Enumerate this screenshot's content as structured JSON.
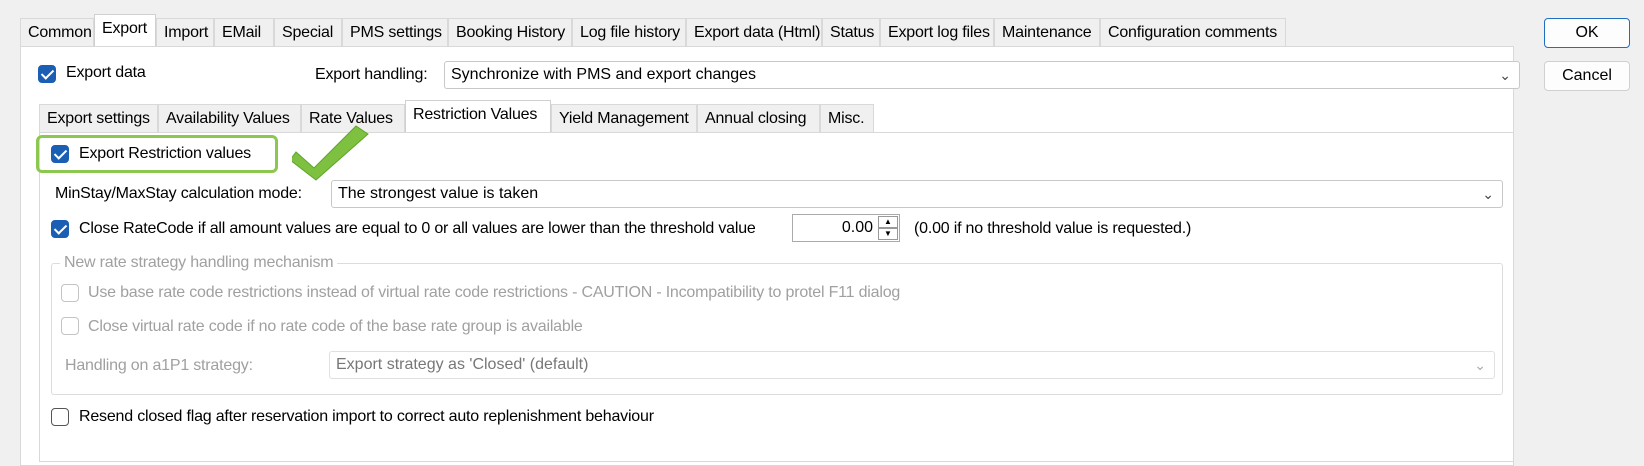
{
  "main_tabs": [
    "Common",
    "Export",
    "Import",
    "EMail",
    "Special",
    "PMS settings",
    "Booking History",
    "Log file history",
    "Export data (Html)",
    "Status",
    "Export log files",
    "Maintenance",
    "Configuration comments"
  ],
  "buttons": {
    "ok": "OK",
    "cancel": "Cancel"
  },
  "export_data": {
    "label": "Export data",
    "checked": true
  },
  "export_handling": {
    "label": "Export handling:",
    "value": "Synchronize with PMS and export changes"
  },
  "sub_tabs": [
    "Export settings",
    "Availability Values",
    "Rate Values",
    "Restriction Values",
    "Yield Management",
    "Annual closing",
    "Misc."
  ],
  "restriction": {
    "export_label": "Export Restriction values",
    "minstay_label": "MinStay/MaxStay calculation mode:",
    "minstay_value": "The strongest value is taken",
    "close_label": "Close RateCode if all amount values are equal to 0 or all values are lower than the threshold value",
    "threshold_value": "0.00",
    "threshold_hint": "(0.00 if no threshold value is requested.)",
    "group_title": "New rate strategy handling mechanism",
    "use_base_label": "Use base rate code restrictions instead of virtual rate code restrictions - CAUTION - Incompatibility to protel F11 dialog",
    "close_virtual_label": "Close virtual rate code if no rate code of the base rate group is available",
    "a1p1_label": "Handling on a1P1 strategy:",
    "a1p1_value": "Export strategy as 'Closed' (default)",
    "resend_label": "Resend closed flag after reservation import to correct auto replenishment behaviour"
  },
  "colors": {
    "accent": "#1a5fb4",
    "highlight": "#8cc850"
  }
}
